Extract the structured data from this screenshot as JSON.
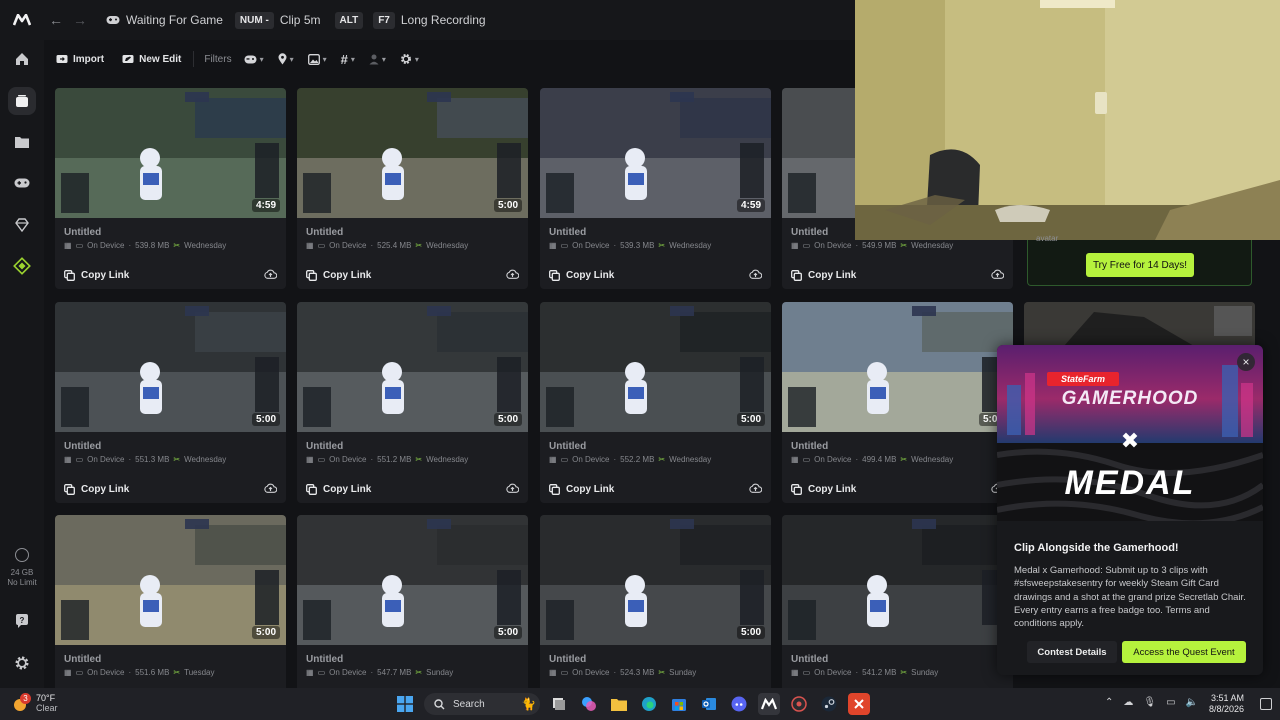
{
  "topbar": {
    "status_text": "Waiting For Game",
    "hotkeys": [
      {
        "key": "NUM -",
        "label": "Clip 5m"
      },
      {
        "key": "ALT",
        "label": ""
      },
      {
        "key": "F7",
        "label": "Long Recording"
      }
    ]
  },
  "toolbar": {
    "import_label": "Import",
    "new_edit_label": "New Edit",
    "filters_label": "Filters"
  },
  "sidebar": {
    "storage_amount": "24 GB",
    "storage_limit": "No Limit"
  },
  "clips": [
    {
      "title": "Untitled",
      "location": "On Device",
      "size": "539.8 MB",
      "day": "Wednesday",
      "duration": "4:59",
      "copy": "Copy Link"
    },
    {
      "title": "Untitled",
      "location": "On Device",
      "size": "525.4 MB",
      "day": "Wednesday",
      "duration": "5:00",
      "copy": "Copy Link"
    },
    {
      "title": "Untitled",
      "location": "On Device",
      "size": "539.3 MB",
      "day": "Wednesday",
      "duration": "4:59",
      "copy": "Copy Link"
    },
    {
      "title": "Untitled",
      "location": "On Device",
      "size": "549.9 MB",
      "day": "Wednesday",
      "duration": "",
      "copy": "Copy Link"
    },
    {
      "title": "Untitled",
      "location": "On Device",
      "size": "551.3 MB",
      "day": "Wednesday",
      "duration": "5:00",
      "copy": "Copy Link"
    },
    {
      "title": "Untitled",
      "location": "On Device",
      "size": "551.2 MB",
      "day": "Wednesday",
      "duration": "5:00",
      "copy": "Copy Link"
    },
    {
      "title": "Untitled",
      "location": "On Device",
      "size": "552.2 MB",
      "day": "Wednesday",
      "duration": "5:00",
      "copy": "Copy Link"
    },
    {
      "title": "Untitled",
      "location": "On Device",
      "size": "499.4 MB",
      "day": "Wednesday",
      "duration": "5:00",
      "copy": "Copy Link"
    },
    {
      "title": "Untitled",
      "location": "On Device",
      "size": "551.6 MB",
      "day": "Tuesday",
      "duration": "5:00",
      "copy": "Copy Link"
    },
    {
      "title": "Untitled",
      "location": "On Device",
      "size": "547.7 MB",
      "day": "Sunday",
      "duration": "5:00",
      "copy": "Copy Link"
    },
    {
      "title": "Untitled",
      "location": "On Device",
      "size": "524.3 MB",
      "day": "Sunday",
      "duration": "5:00",
      "copy": "Copy Link"
    },
    {
      "title": "Untitled",
      "location": "On Device",
      "size": "541.2 MB",
      "day": "Sunday",
      "duration": "",
      "copy": "Copy Link"
    }
  ],
  "promo": {
    "partial_text": "avatar",
    "trial_button": "Try Free for 14 Days!"
  },
  "quest": {
    "sponsor": "StateFarm",
    "event_name": "GAMERHOOD",
    "brand": "MEDAL",
    "title": "Clip Alongside the Gamerhood!",
    "body": "Medal x Gamerhood: Submit up to 3 clips with #sfsweepstakesentry for weekly Steam Gift Card drawings and a shot at the grand prize Secretlab Chair. Every entry earns a free badge too. Terms and conditions apply.",
    "details_button": "Contest Details",
    "access_button": "Access the Quest Event"
  },
  "taskbar": {
    "temperature": "70°F",
    "condition": "Clear",
    "weather_badge": "3",
    "search_label": "Search",
    "time": "3:51 AM",
    "date": "8/8/2026"
  },
  "colors": {
    "accent": "#b6f23d",
    "sidebar_active": "#9cd42f"
  }
}
